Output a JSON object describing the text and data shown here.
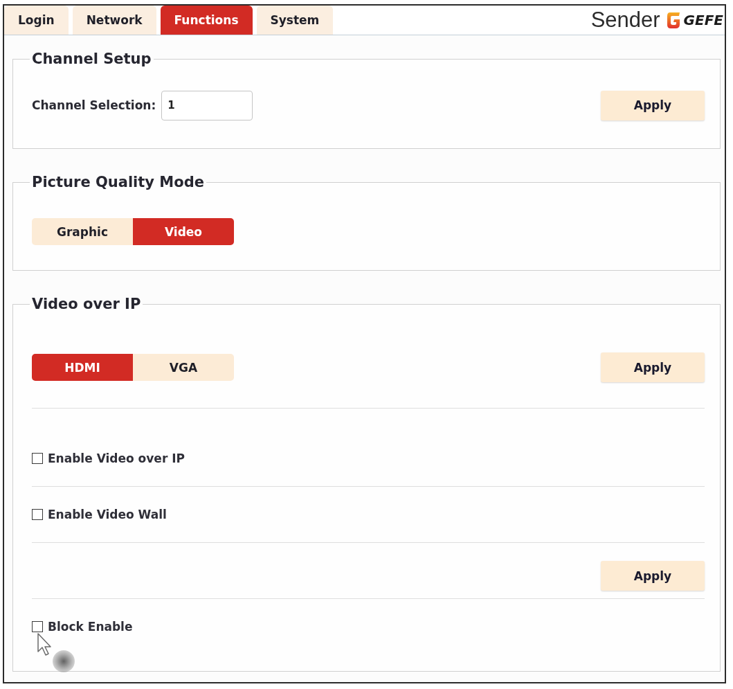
{
  "tabs": [
    {
      "label": "Login",
      "selected": false
    },
    {
      "label": "Network",
      "selected": false
    },
    {
      "label": "Functions",
      "selected": true
    },
    {
      "label": "System",
      "selected": false
    }
  ],
  "header": {
    "title": "Sender",
    "logo_text": "GEFE"
  },
  "sections": [
    {
      "legend": "Channel Setup",
      "rows": [
        {
          "kind": "field",
          "label": "Channel Selection:",
          "value": "1",
          "button": "Apply"
        }
      ]
    },
    {
      "legend": "Picture Quality Mode",
      "rows": [
        {
          "kind": "segmented",
          "options": [
            {
              "label": "Graphic",
              "selected": false
            },
            {
              "label": "Video",
              "selected": true
            }
          ]
        }
      ]
    },
    {
      "legend": "Video over IP",
      "rows": [
        {
          "kind": "segmented",
          "options": [
            {
              "label": "HDMI",
              "selected": true
            },
            {
              "label": "VGA",
              "selected": false
            }
          ],
          "button": "Apply"
        },
        {
          "kind": "checkbox",
          "label": "Enable Video over IP",
          "checked": false
        },
        {
          "kind": "checkbox",
          "label": "Enable Video Wall",
          "checked": false
        },
        {
          "kind": "action",
          "button": "Apply"
        },
        {
          "kind": "checkbox",
          "label": "Block Enable",
          "checked": false,
          "hovered": true
        }
      ]
    }
  ]
}
